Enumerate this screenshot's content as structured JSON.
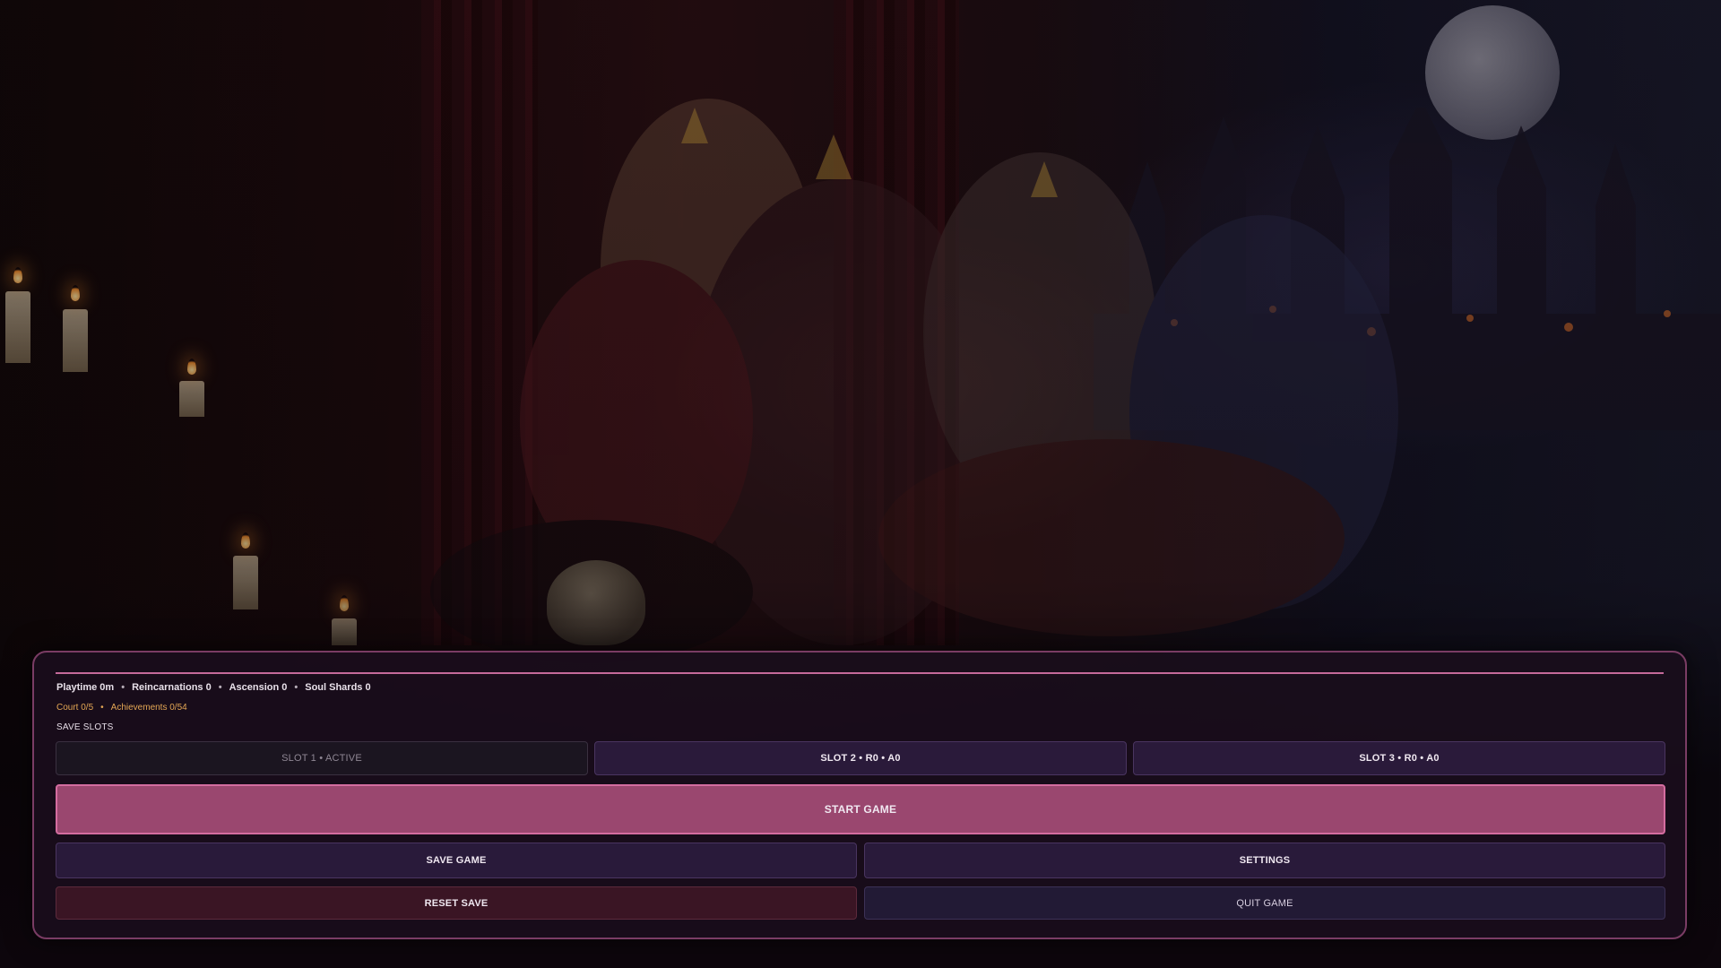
{
  "background": {
    "scene": "dark-fantasy-court-artwork",
    "icons": [
      "moon-icon",
      "castle-icon",
      "candle-icon",
      "skull-icon"
    ]
  },
  "stats": {
    "playtime": "Playtime 0m",
    "reincarnations": "Reincarnations 0",
    "ascension": "Ascension 0",
    "soul_shards": "Soul Shards 0",
    "separator": "•"
  },
  "progress": {
    "court": "Court 0/5",
    "achievements": "Achievements 0/54",
    "separator": "•"
  },
  "save_slots": {
    "heading": "SAVE SLOTS",
    "slots": [
      {
        "label": "SLOT 1 • ACTIVE"
      },
      {
        "label": "SLOT 2 • R0 • A0"
      },
      {
        "label": "SLOT 3 • R0 • A0"
      }
    ]
  },
  "actions": {
    "start": "START GAME",
    "save": "SAVE GAME",
    "settings": "SETTINGS",
    "reset": "RESET SAVE",
    "quit": "QUIT GAME"
  },
  "colors": {
    "panel_border": "#7a3c64",
    "accent_pink": "#c56a9a",
    "start_button": "#9a476f",
    "progress_text": "#e3a654",
    "reset_button": "#3a1524"
  }
}
